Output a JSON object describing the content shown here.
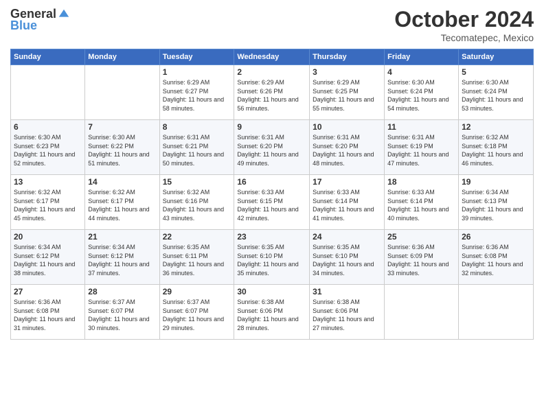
{
  "logo": {
    "general": "General",
    "blue": "Blue"
  },
  "title": "October 2024",
  "location": "Tecomatepec, Mexico",
  "weekdays": [
    "Sunday",
    "Monday",
    "Tuesday",
    "Wednesday",
    "Thursday",
    "Friday",
    "Saturday"
  ],
  "weeks": [
    [
      {
        "day": "",
        "info": ""
      },
      {
        "day": "",
        "info": ""
      },
      {
        "day": "1",
        "info": "Sunrise: 6:29 AM\nSunset: 6:27 PM\nDaylight: 11 hours and 58 minutes."
      },
      {
        "day": "2",
        "info": "Sunrise: 6:29 AM\nSunset: 6:26 PM\nDaylight: 11 hours and 56 minutes."
      },
      {
        "day": "3",
        "info": "Sunrise: 6:29 AM\nSunset: 6:25 PM\nDaylight: 11 hours and 55 minutes."
      },
      {
        "day": "4",
        "info": "Sunrise: 6:30 AM\nSunset: 6:24 PM\nDaylight: 11 hours and 54 minutes."
      },
      {
        "day": "5",
        "info": "Sunrise: 6:30 AM\nSunset: 6:24 PM\nDaylight: 11 hours and 53 minutes."
      }
    ],
    [
      {
        "day": "6",
        "info": "Sunrise: 6:30 AM\nSunset: 6:23 PM\nDaylight: 11 hours and 52 minutes."
      },
      {
        "day": "7",
        "info": "Sunrise: 6:30 AM\nSunset: 6:22 PM\nDaylight: 11 hours and 51 minutes."
      },
      {
        "day": "8",
        "info": "Sunrise: 6:31 AM\nSunset: 6:21 PM\nDaylight: 11 hours and 50 minutes."
      },
      {
        "day": "9",
        "info": "Sunrise: 6:31 AM\nSunset: 6:20 PM\nDaylight: 11 hours and 49 minutes."
      },
      {
        "day": "10",
        "info": "Sunrise: 6:31 AM\nSunset: 6:20 PM\nDaylight: 11 hours and 48 minutes."
      },
      {
        "day": "11",
        "info": "Sunrise: 6:31 AM\nSunset: 6:19 PM\nDaylight: 11 hours and 47 minutes."
      },
      {
        "day": "12",
        "info": "Sunrise: 6:32 AM\nSunset: 6:18 PM\nDaylight: 11 hours and 46 minutes."
      }
    ],
    [
      {
        "day": "13",
        "info": "Sunrise: 6:32 AM\nSunset: 6:17 PM\nDaylight: 11 hours and 45 minutes."
      },
      {
        "day": "14",
        "info": "Sunrise: 6:32 AM\nSunset: 6:17 PM\nDaylight: 11 hours and 44 minutes."
      },
      {
        "day": "15",
        "info": "Sunrise: 6:32 AM\nSunset: 6:16 PM\nDaylight: 11 hours and 43 minutes."
      },
      {
        "day": "16",
        "info": "Sunrise: 6:33 AM\nSunset: 6:15 PM\nDaylight: 11 hours and 42 minutes."
      },
      {
        "day": "17",
        "info": "Sunrise: 6:33 AM\nSunset: 6:14 PM\nDaylight: 11 hours and 41 minutes."
      },
      {
        "day": "18",
        "info": "Sunrise: 6:33 AM\nSunset: 6:14 PM\nDaylight: 11 hours and 40 minutes."
      },
      {
        "day": "19",
        "info": "Sunrise: 6:34 AM\nSunset: 6:13 PM\nDaylight: 11 hours and 39 minutes."
      }
    ],
    [
      {
        "day": "20",
        "info": "Sunrise: 6:34 AM\nSunset: 6:12 PM\nDaylight: 11 hours and 38 minutes."
      },
      {
        "day": "21",
        "info": "Sunrise: 6:34 AM\nSunset: 6:12 PM\nDaylight: 11 hours and 37 minutes."
      },
      {
        "day": "22",
        "info": "Sunrise: 6:35 AM\nSunset: 6:11 PM\nDaylight: 11 hours and 36 minutes."
      },
      {
        "day": "23",
        "info": "Sunrise: 6:35 AM\nSunset: 6:10 PM\nDaylight: 11 hours and 35 minutes."
      },
      {
        "day": "24",
        "info": "Sunrise: 6:35 AM\nSunset: 6:10 PM\nDaylight: 11 hours and 34 minutes."
      },
      {
        "day": "25",
        "info": "Sunrise: 6:36 AM\nSunset: 6:09 PM\nDaylight: 11 hours and 33 minutes."
      },
      {
        "day": "26",
        "info": "Sunrise: 6:36 AM\nSunset: 6:08 PM\nDaylight: 11 hours and 32 minutes."
      }
    ],
    [
      {
        "day": "27",
        "info": "Sunrise: 6:36 AM\nSunset: 6:08 PM\nDaylight: 11 hours and 31 minutes."
      },
      {
        "day": "28",
        "info": "Sunrise: 6:37 AM\nSunset: 6:07 PM\nDaylight: 11 hours and 30 minutes."
      },
      {
        "day": "29",
        "info": "Sunrise: 6:37 AM\nSunset: 6:07 PM\nDaylight: 11 hours and 29 minutes."
      },
      {
        "day": "30",
        "info": "Sunrise: 6:38 AM\nSunset: 6:06 PM\nDaylight: 11 hours and 28 minutes."
      },
      {
        "day": "31",
        "info": "Sunrise: 6:38 AM\nSunset: 6:06 PM\nDaylight: 11 hours and 27 minutes."
      },
      {
        "day": "",
        "info": ""
      },
      {
        "day": "",
        "info": ""
      }
    ]
  ]
}
